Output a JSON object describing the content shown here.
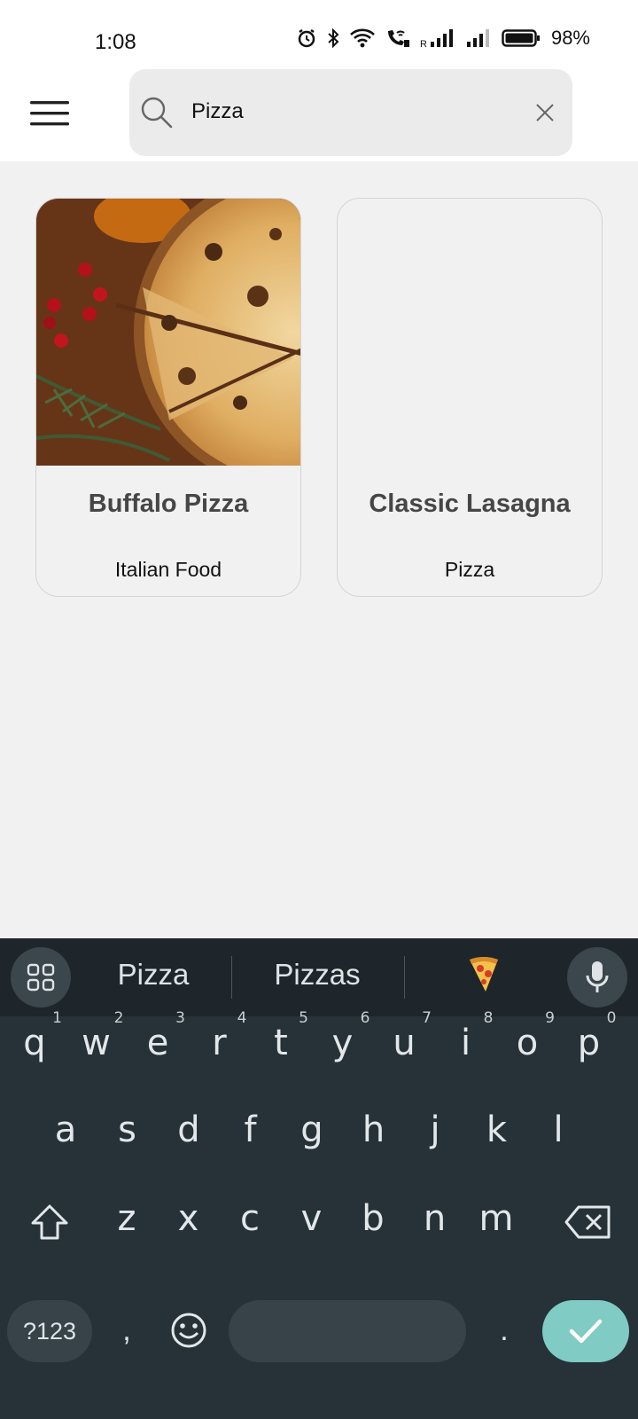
{
  "status_bar": {
    "time": "1:08",
    "battery": "98%",
    "icons": [
      "alarm-icon",
      "bluetooth-icon",
      "wifi-icon",
      "wifi-calling-icon",
      "signal-roaming-icon",
      "signal-icon",
      "battery-icon"
    ]
  },
  "app_bar": {
    "menu_icon": "hamburger-menu-icon",
    "search": {
      "value": "Pizza",
      "icon": "search-icon",
      "clear_icon": "close-icon"
    }
  },
  "results": [
    {
      "title": "Buffalo Pizza",
      "subtitle": "Italian Food",
      "has_image": true
    },
    {
      "title": "Classic Lasagna",
      "subtitle": "Pizza",
      "has_image": false
    }
  ],
  "keyboard": {
    "suggestions": [
      "Pizza",
      "Pizzas"
    ],
    "suggestion_emoji": "🍕",
    "row1": [
      {
        "k": "q",
        "n": "1"
      },
      {
        "k": "w",
        "n": "2"
      },
      {
        "k": "e",
        "n": "3"
      },
      {
        "k": "r",
        "n": "4"
      },
      {
        "k": "t",
        "n": "5"
      },
      {
        "k": "y",
        "n": "6"
      },
      {
        "k": "u",
        "n": "7"
      },
      {
        "k": "i",
        "n": "8"
      },
      {
        "k": "o",
        "n": "9"
      },
      {
        "k": "p",
        "n": "0"
      }
    ],
    "row2": [
      "a",
      "s",
      "d",
      "f",
      "g",
      "h",
      "j",
      "k",
      "l"
    ],
    "row3": [
      "z",
      "x",
      "c",
      "v",
      "b",
      "n",
      "m"
    ],
    "symbols_label": "?123",
    "comma": ",",
    "period": ".",
    "colors": {
      "background": "#263238",
      "enter": "#80cbc4"
    }
  }
}
